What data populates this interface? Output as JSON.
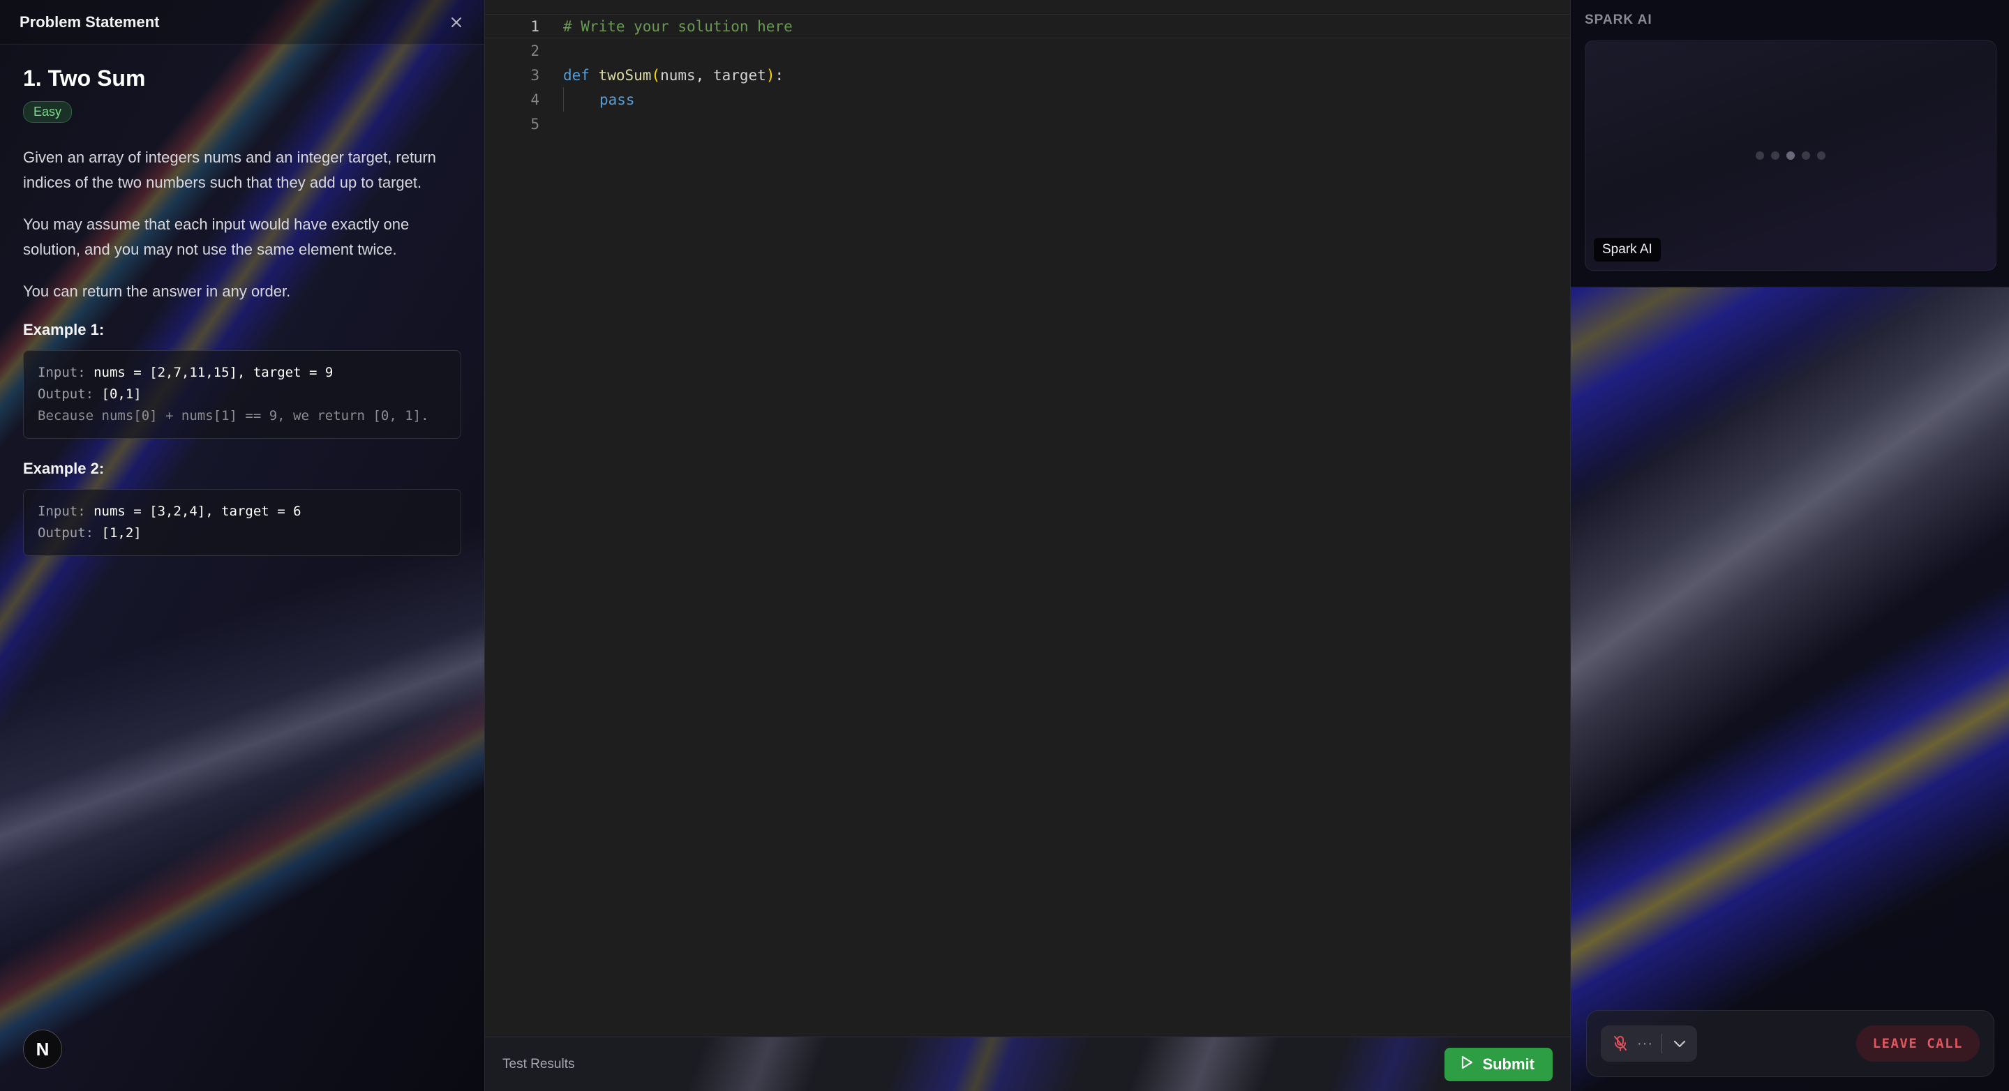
{
  "problem_panel": {
    "header_title": "Problem Statement",
    "title": "1. Two Sum",
    "difficulty": "Easy",
    "paragraphs": [
      "Given an array of integers nums and an integer target, return indices of the two numbers such that they add up to target.",
      "You may assume that each input would have exactly one solution, and you may not use the same element twice.",
      "You can return the answer in any order."
    ],
    "examples": [
      {
        "heading": "Example 1:",
        "input_key": "Input:",
        "input_val": "nums = [2,7,11,15], target = 9",
        "output_key": "Output:",
        "output_val": "[0,1]",
        "explanation": "Because nums[0] + nums[1] == 9, we return [0, 1]."
      },
      {
        "heading": "Example 2:",
        "input_key": "Input:",
        "input_val": "nums = [3,2,4], target = 6",
        "output_key": "Output:",
        "output_val": "[1,2]"
      }
    ],
    "logo_letter": "N"
  },
  "editor": {
    "line_numbers": [
      "1",
      "2",
      "3",
      "4",
      "5"
    ],
    "line1_comment": "# Write your solution here",
    "line3_kw": "def",
    "line3_fn": "twoSum",
    "line3_open": "(",
    "line3_params": "nums, target",
    "line3_close": ")",
    "line3_colon": ":",
    "line4_kw": "pass"
  },
  "bottom_bar": {
    "test_results_label": "Test Results",
    "submit_label": "Submit"
  },
  "spark": {
    "header": "SPARK AI",
    "tile_label": "Spark AI",
    "dots_label": "···",
    "leave_call_label": "LEAVE CALL"
  },
  "colors": {
    "submit_green": "#2e9e44",
    "leave_call_red": "#e0565e",
    "easy_badge_green": "#7ddc8a",
    "editor_bg": "#1e1e1e"
  },
  "icons": [
    "close-icon",
    "play-icon",
    "mic-off-icon",
    "dots-icon",
    "chevron-down-icon"
  ]
}
